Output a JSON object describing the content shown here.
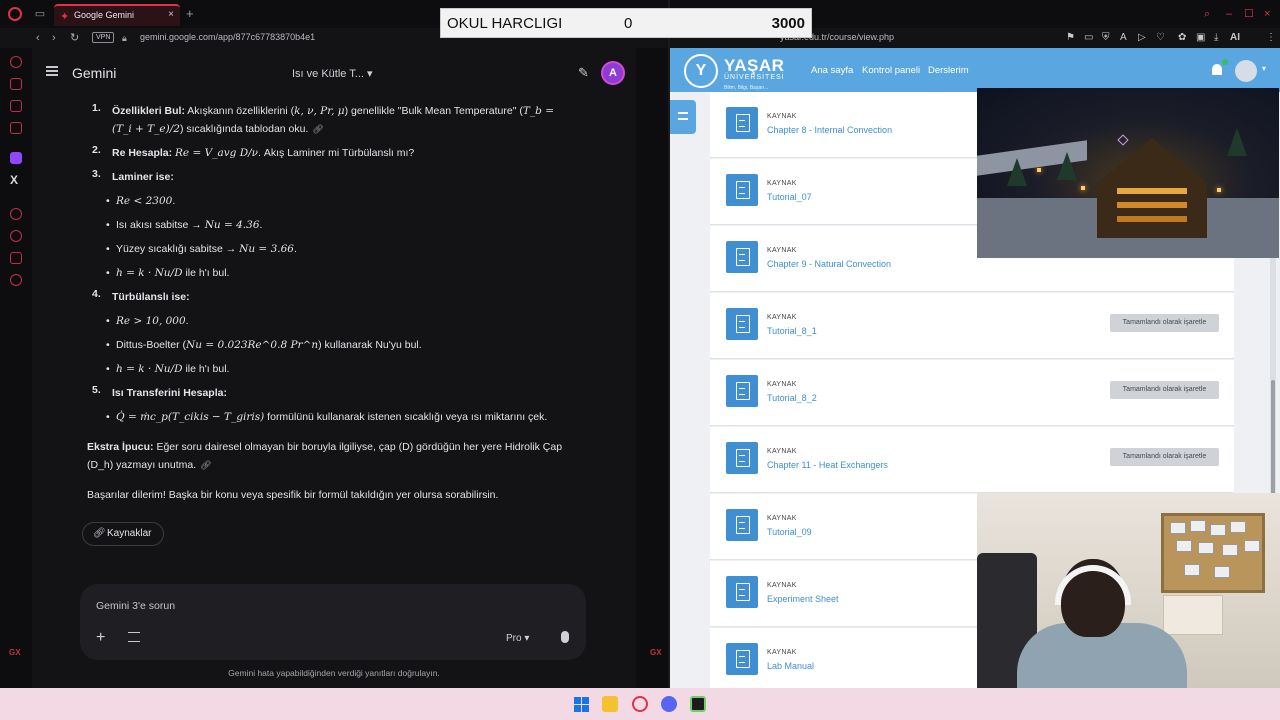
{
  "left_browser": {
    "tab_title": "Google Gemini",
    "vpn_label": "VPN",
    "url": "gemini.google.com/app/877c67783870b4e1"
  },
  "gemini": {
    "app_title": "Gemini",
    "conversation_title": "Isı ve Kütle T...",
    "avatar_initial": "A",
    "steps": [
      {
        "num": "1.",
        "title": "Özellikleri Bul:",
        "text_a": " Akışkanın özelliklerini (",
        "math_a": "k, ν, Pr, μ",
        "text_b": ") genellikle \"Bulk Mean Temperature\" (",
        "math_b": "T_b =",
        "line2_math": "(T_i + T_e)/2",
        "line2_text": ") sıcaklığında tablodan oku."
      },
      {
        "num": "2.",
        "title": "Re Hesapla:",
        "math": "Re = V_avg D/ν",
        "text": ". Akış Laminer mi Türbülanslı mı?"
      },
      {
        "num": "3.",
        "title": "Laminer ise:"
      },
      {
        "num": "4.",
        "title": "Türbülanslı ise:"
      },
      {
        "num": "5.",
        "title": "Isı Transferini Hesapla:"
      }
    ],
    "laminar_bullets": [
      {
        "text": "",
        "math": "Re < 2300",
        "suffix": "."
      },
      {
        "text": "Isı akısı sabitse → ",
        "math": "Nu = 4.36",
        "suffix": "."
      },
      {
        "text": "Yüzey sıcaklığı sabitse → ",
        "math": "Nu = 3.66",
        "suffix": "."
      },
      {
        "text": "",
        "math": "h = k · Nu/D",
        "suffix": " ile h'ı bul."
      }
    ],
    "turbulent_bullets": [
      {
        "text": "",
        "math": "Re > 10, 000",
        "suffix": "."
      },
      {
        "text": "Dittus-Boelter (",
        "math": "Nu = 0.023Re^0.8 Pr^n",
        "suffix": ") kullanarak Nu'yu bul."
      },
      {
        "text": "",
        "math": "h = k · Nu/D",
        "suffix": " ile h'ı bul."
      }
    ],
    "heat_bullet": {
      "math": "Q̇ = ṁc_p(T_cikis − T_giris)",
      "suffix": " formülünü kullanarak istenen sıcaklığı veya ısı miktarını çek."
    },
    "tip_title": "Ekstra İpucu:",
    "tip_text_1": " Eğer soru dairesel olmayan bir boruyla ilgiliyse, çap (D) gördüğün her yere Hidrolik Çap",
    "tip_text_2": "(D_h) yazmayı unutma.",
    "closing": "Başarılar dilerim! Başka bir konu veya spesifik bir formül takıldığın yer olursa sorabilirsin.",
    "sources_label": "Kaynaklar",
    "prompt_placeholder": "Gemini 3'e sorun",
    "model_label": "Pro",
    "disclaimer": "Gemini hata yapabildiğinden verdiği yanıtları doğrulayın."
  },
  "right_browser": {
    "url": "yasar.edu.tr/course/view.php",
    "ext_label": "AI"
  },
  "moodle": {
    "logo_main": "YAŞAR",
    "logo_sub": "ÜNİVERSİTESİ",
    "logo_tag": "Bilim, Bilgi, Başarı...",
    "nav": [
      "Ana sayfa",
      "Kontrol paneli",
      "Derslerim"
    ],
    "notification_count": "1",
    "activities": [
      {
        "type": "KAYNAK",
        "name": "Chapter 8 - Internal Convection",
        "button": ""
      },
      {
        "type": "KAYNAK",
        "name": "Tutorial_07",
        "button": ""
      },
      {
        "type": "KAYNAK",
        "name": "Chapter 9 - Natural Convection",
        "button": ""
      },
      {
        "type": "KAYNAK",
        "name": "Tutorial_8_1",
        "button": "Tamamlandı olarak işaretle"
      },
      {
        "type": "KAYNAK",
        "name": "Tutorial_8_2",
        "button": "Tamamlandı olarak işaretle"
      },
      {
        "type": "KAYNAK",
        "name": "Chapter 11 - Heat Exchangers",
        "button": "Tamamlandı olarak işaretle"
      },
      {
        "type": "KAYNAK",
        "name": "Tutorial_09",
        "button": ""
      },
      {
        "type": "KAYNAK",
        "name": "Experiment Sheet",
        "button": ""
      },
      {
        "type": "KAYNAK",
        "name": "Lab Manual",
        "button": ""
      }
    ]
  },
  "overlay": {
    "label": "OKUL HARCLIGI",
    "current": "0",
    "goal": "3000"
  },
  "colors": {
    "opera_accent": "#e0324b",
    "moodle_blue": "#5aa6e0",
    "link_blue": "#3d8fd6"
  }
}
